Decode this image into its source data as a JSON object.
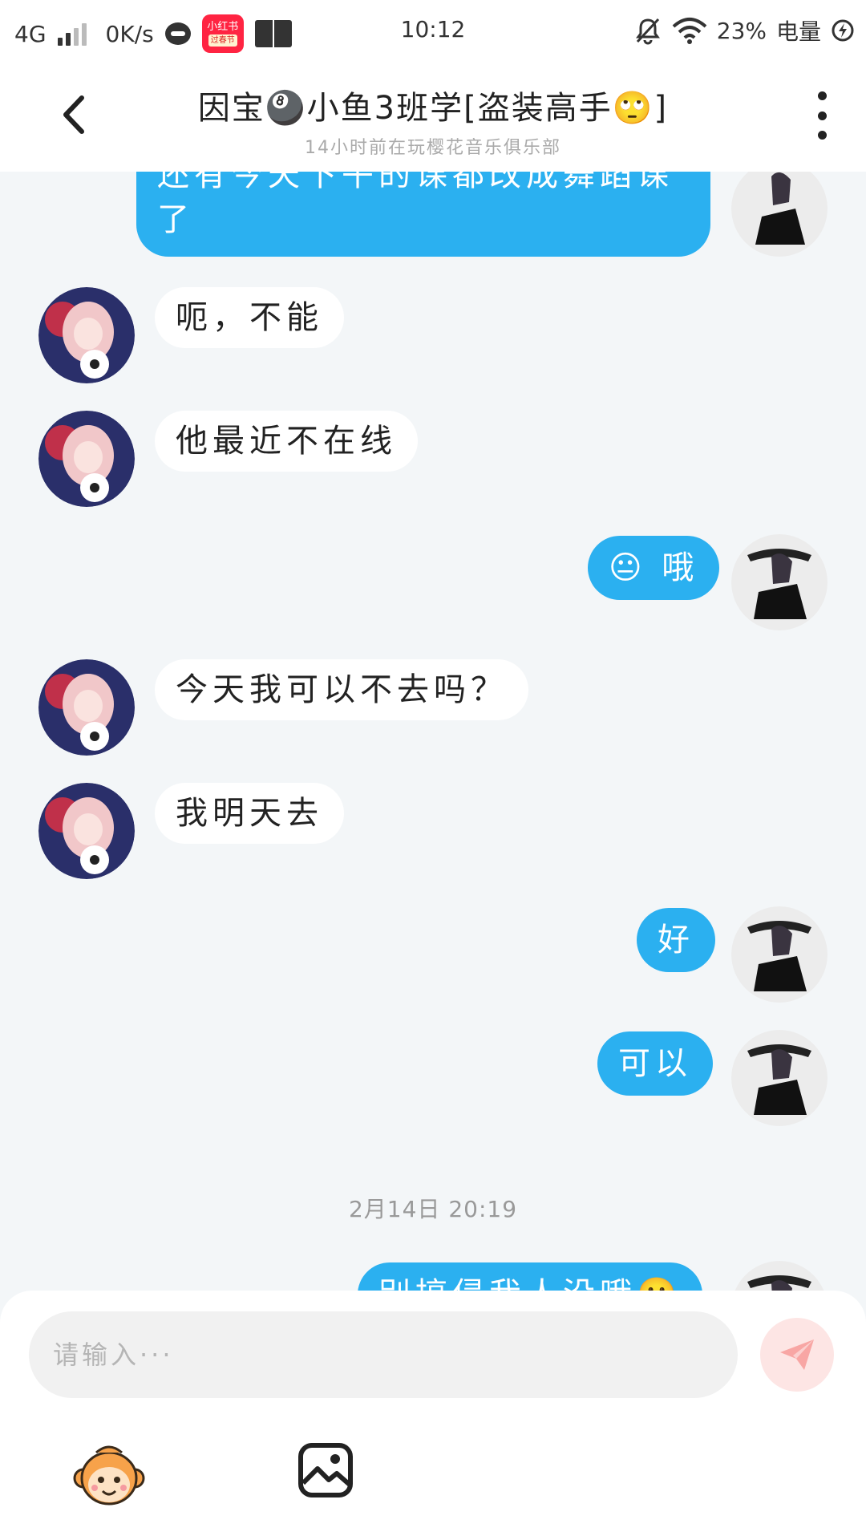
{
  "status_bar": {
    "network": "4G",
    "speed": "0K/s",
    "app_badge_title": "小红书",
    "app_badge_sub": "过春节",
    "time": "10:12",
    "battery_percent": "23%",
    "battery_label": "电量",
    "icons": [
      "signal-icon",
      "cat-icon",
      "xiaohongshu-app-icon",
      "book-icon",
      "mute-bell-icon",
      "wifi-icon",
      "battery-charging-icon"
    ]
  },
  "header": {
    "title": "因宝🎱小鱼3班学[盗装高手🙄]",
    "subtitle": "14小时前在玩樱花音乐俱乐部",
    "back_icon": "chevron-left-icon",
    "more_icon": "more-vertical-icon"
  },
  "messages": [
    {
      "side": "out",
      "text_line1": "还有今天下午的课都改成舞蹈课",
      "text_line2": "了"
    },
    {
      "side": "in",
      "text": "呃，不能"
    },
    {
      "side": "in",
      "text": "他最近不在线"
    },
    {
      "side": "out",
      "text": "😐 哦"
    },
    {
      "side": "in",
      "text": "今天我可以不去吗？"
    },
    {
      "side": "in",
      "text": "我明天去"
    },
    {
      "side": "out",
      "text": "好"
    },
    {
      "side": "out",
      "text": "可以"
    },
    {
      "side": "out",
      "text": "别搞侵我人没哦🙂"
    }
  ],
  "timestamp": "2月14日 20:19",
  "input": {
    "placeholder": "请输入···",
    "value": ""
  },
  "colors": {
    "outgoing_bubble": "#2bb0f0",
    "incoming_bubble": "#ffffff",
    "chat_background": "#f3f6f8",
    "send_button_bg": "#fde5e4",
    "send_button_icon": "#f8a6a4"
  },
  "toolbar": {
    "emoji_icon": "monkey-emoji-icon",
    "image_icon": "image-icon",
    "send_icon": "paper-plane-icon"
  }
}
